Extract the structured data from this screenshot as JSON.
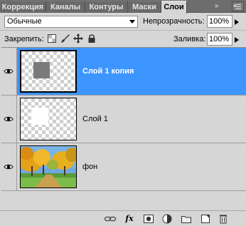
{
  "tabs": [
    {
      "label": "Коррекция",
      "active": false
    },
    {
      "label": "Каналы",
      "active": false
    },
    {
      "label": "Контуры",
      "active": false
    },
    {
      "label": "Маски",
      "active": false
    },
    {
      "label": "Слои",
      "active": true
    }
  ],
  "tab_overflow_glyph": "»",
  "blend_mode": {
    "value": "Обычные"
  },
  "opacity": {
    "label": "Непрозрачность:",
    "value": "100%"
  },
  "lock": {
    "label": "Закрепить:",
    "icons": [
      "lock-transparent-icon",
      "lock-image-icon",
      "lock-position-icon",
      "lock-all-icon"
    ]
  },
  "fill": {
    "label": "Заливка:",
    "value": "100%"
  },
  "layers": [
    {
      "name": "Слой 1 копия",
      "selected": true,
      "visible": true,
      "thumbnail": "gray-square-on-transparent"
    },
    {
      "name": "Слой 1",
      "selected": false,
      "visible": true,
      "thumbnail": "white-square-on-transparent"
    },
    {
      "name": "фон",
      "selected": false,
      "visible": true,
      "thumbnail": "autumn-trees-photo"
    }
  ],
  "bottom_tools": [
    {
      "name": "link-layers-icon",
      "glyph": "⊂⊃"
    },
    {
      "name": "fx-icon",
      "glyph": "fx"
    },
    {
      "name": "add-mask-icon",
      "glyph": ""
    },
    {
      "name": "adjustment-layer-icon",
      "glyph": ""
    },
    {
      "name": "new-group-icon",
      "glyph": ""
    },
    {
      "name": "new-layer-icon",
      "glyph": ""
    },
    {
      "name": "trash-icon",
      "glyph": ""
    }
  ],
  "colors": {
    "selection": "#3d95ff",
    "panel": "#d6d6d6",
    "tabbar": "#6d6d6d"
  }
}
